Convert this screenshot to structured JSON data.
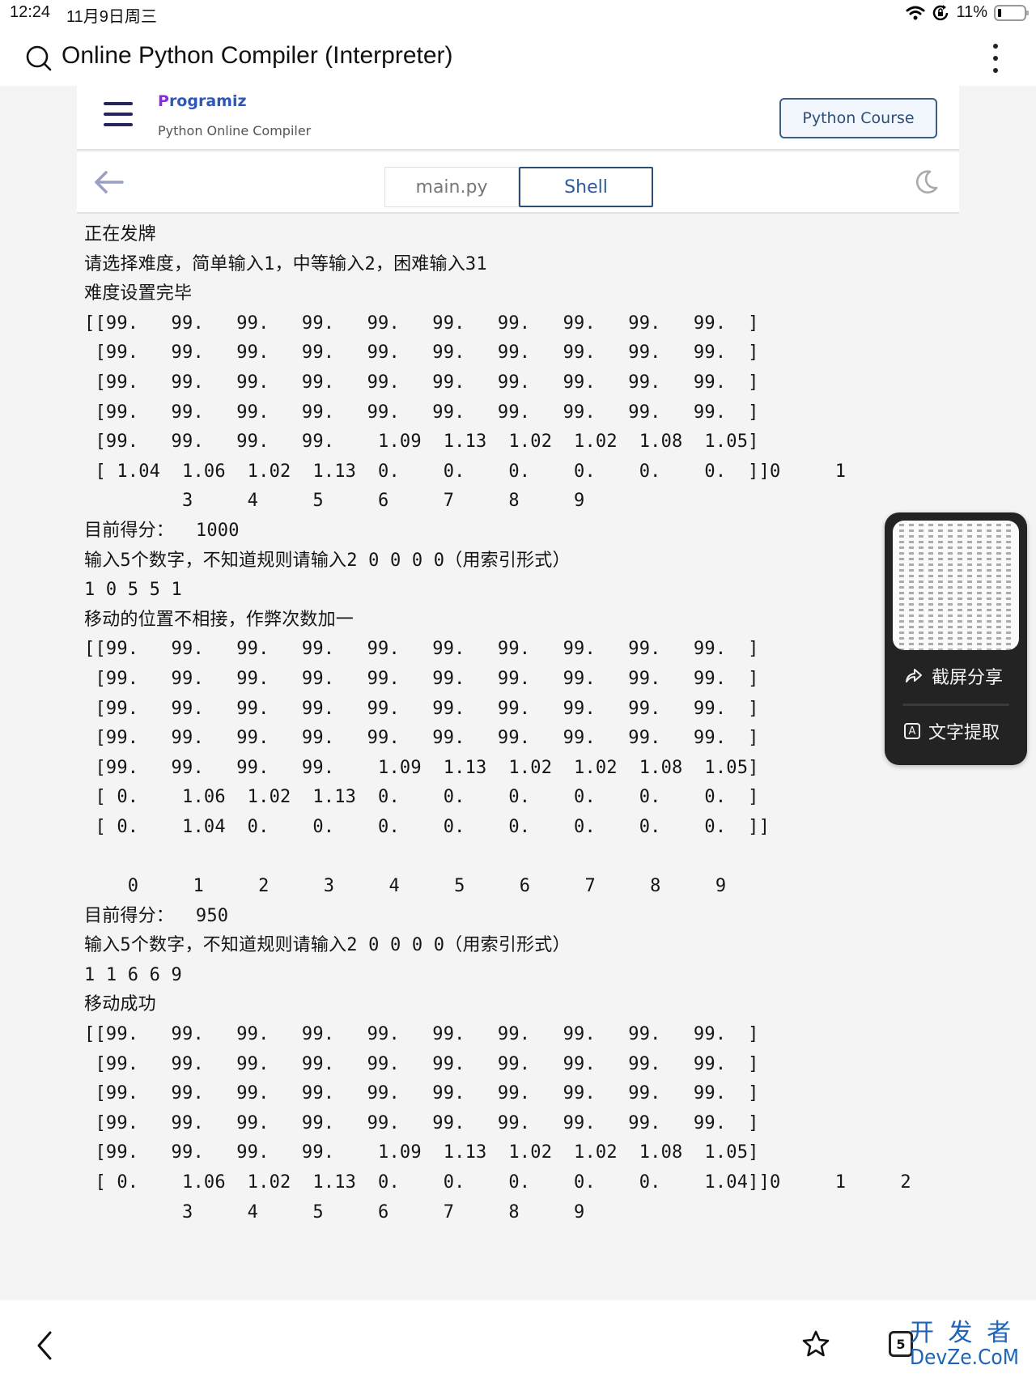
{
  "status_bar": {
    "time": "12:24",
    "date": "11月9日周三",
    "battery": "11%"
  },
  "browser": {
    "address_title": "Online Python Compiler (Interpreter)",
    "search_icon": "search-icon",
    "more_icon": "more-vertical-icon"
  },
  "header": {
    "logo": "Programiz",
    "logo_first": "P",
    "logo_rest": "rogramiz",
    "subtitle": "Python Online Compiler",
    "course_button": "Python Course"
  },
  "toolbar": {
    "tabs": [
      {
        "label": "main.py",
        "active": false
      },
      {
        "label": "Shell",
        "active": true
      }
    ]
  },
  "shell_output": [
    "正在发牌",
    "请选择难度，简单输入1，中等输入2，困难输入31",
    "难度设置完毕",
    "[[99.   99.   99.   99.   99.   99.   99.   99.   99.   99.  ]",
    " [99.   99.   99.   99.   99.   99.   99.   99.   99.   99.  ]",
    " [99.   99.   99.   99.   99.   99.   99.   99.   99.   99.  ]",
    " [99.   99.   99.   99.   99.   99.   99.   99.   99.   99.  ]",
    " [99.   99.   99.   99.    1.09  1.13  1.02  1.02  1.08  1.05]",
    " [ 1.04  1.06  1.02  1.13  0.    0.    0.    0.    0.    0.  ]]0     1",
    "         3     4     5     6     7     8     9",
    "目前得分：  1000",
    "输入5个数字，不知道规则请输入2 0 0 0 0（用索引形式）",
    "1 0 5 5 1",
    "移动的位置不相接，作弊次数加一",
    "[[99.   99.   99.   99.   99.   99.   99.   99.   99.   99.  ]",
    " [99.   99.   99.   99.   99.   99.   99.   99.   99.   99.  ]",
    " [99.   99.   99.   99.   99.   99.   99.   99.   99.   99.  ]",
    " [99.   99.   99.   99.   99.   99.   99.   99.   99.   99.  ]",
    " [99.   99.   99.   99.    1.09  1.13  1.02  1.02  1.08  1.05]",
    " [ 0.    1.06  1.02  1.13  0.    0.    0.    0.    0.    0.  ]",
    " [ 0.    1.04  0.    0.    0.    0.    0.    0.    0.    0.  ]]",
    "",
    "    0     1     2     3     4     5     6     7     8     9",
    "目前得分：  950",
    "输入5个数字，不知道规则请输入2 0 0 0 0（用索引形式）",
    "1 1 6 6 9",
    "移动成功",
    "[[99.   99.   99.   99.   99.   99.   99.   99.   99.   99.  ]",
    " [99.   99.   99.   99.   99.   99.   99.   99.   99.   99.  ]",
    " [99.   99.   99.   99.   99.   99.   99.   99.   99.   99.  ]",
    " [99.   99.   99.   99.   99.   99.   99.   99.   99.   99.  ]",
    " [99.   99.   99.   99.    1.09  1.13  1.02  1.02  1.08  1.05]",
    " [ 0.    1.06  1.02  1.13  0.    0.    0.    0.    0.    1.04]]0     1     2",
    "         3     4     5     6     7     8     9"
  ],
  "screenshot_popup": {
    "share_label": "截屏分享",
    "extract_label": "文字提取",
    "extract_icon_letter": "A"
  },
  "bottom_bar": {
    "tab_count": "5",
    "watermark_line1": "开 发 者",
    "watermark_line2": "DevZe.CoM"
  },
  "colors": {
    "accent": "#2d4d78",
    "logo_blue": "#2e57b8",
    "page_bg": "#f4f4f4",
    "popup_bg": "#232323"
  }
}
